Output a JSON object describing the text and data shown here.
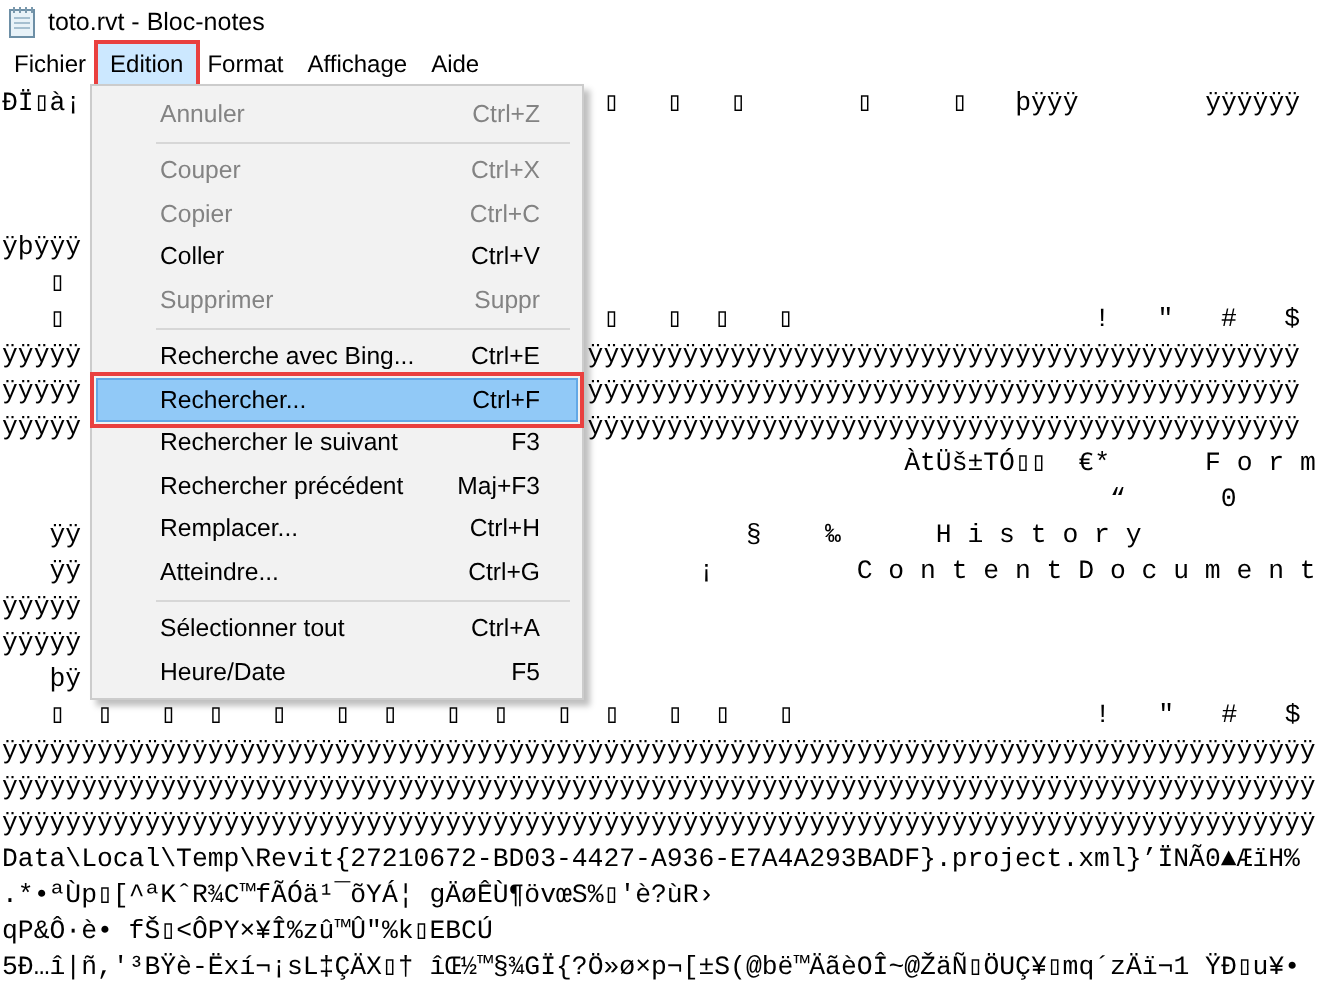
{
  "window": {
    "title": "toto.rvt - Bloc-notes"
  },
  "menu_bar": [
    {
      "label": "Fichier",
      "selected": false,
      "callout": false
    },
    {
      "label": "Edition",
      "selected": true,
      "callout": true
    },
    {
      "label": "Format",
      "selected": false,
      "callout": false
    },
    {
      "label": "Affichage",
      "selected": false,
      "callout": false
    },
    {
      "label": "Aide",
      "selected": false,
      "callout": false
    }
  ],
  "edit_menu": [
    {
      "kind": "item",
      "label": "Annuler",
      "shortcut": "Ctrl+Z",
      "disabled": true,
      "selected": false,
      "callout": false
    },
    {
      "kind": "separator"
    },
    {
      "kind": "item",
      "label": "Couper",
      "shortcut": "Ctrl+X",
      "disabled": true,
      "selected": false,
      "callout": false
    },
    {
      "kind": "item",
      "label": "Copier",
      "shortcut": "Ctrl+C",
      "disabled": true,
      "selected": false,
      "callout": false
    },
    {
      "kind": "item",
      "label": "Coller",
      "shortcut": "Ctrl+V",
      "disabled": false,
      "selected": false,
      "callout": false
    },
    {
      "kind": "item",
      "label": "Supprimer",
      "shortcut": "Suppr",
      "disabled": true,
      "selected": false,
      "callout": false
    },
    {
      "kind": "separator"
    },
    {
      "kind": "item",
      "label": "Recherche avec Bing...",
      "shortcut": "Ctrl+E",
      "disabled": false,
      "selected": false,
      "callout": false
    },
    {
      "kind": "item",
      "label": "Rechercher...",
      "shortcut": "Ctrl+F",
      "disabled": false,
      "selected": true,
      "callout": true
    },
    {
      "kind": "item",
      "label": "Rechercher le suivant",
      "shortcut": "F3",
      "disabled": false,
      "selected": false,
      "callout": false
    },
    {
      "kind": "item",
      "label": "Rechercher précédent",
      "shortcut": "Maj+F3",
      "disabled": false,
      "selected": false,
      "callout": false
    },
    {
      "kind": "item",
      "label": "Remplacer...",
      "shortcut": "Ctrl+H",
      "disabled": false,
      "selected": false,
      "callout": false
    },
    {
      "kind": "item",
      "label": "Atteindre...",
      "shortcut": "Ctrl+G",
      "disabled": false,
      "selected": false,
      "callout": false
    },
    {
      "kind": "separator"
    },
    {
      "kind": "item",
      "label": "Sélectionner tout",
      "shortcut": "Ctrl+A",
      "disabled": false,
      "selected": false,
      "callout": false
    },
    {
      "kind": "item",
      "label": "Heure/Date",
      "shortcut": "F5",
      "disabled": false,
      "selected": false,
      "callout": false
    }
  ],
  "document_lines": [
    {
      "kind": "split",
      "left": "ÐÏ▯à¡",
      "right": " ▯   ▯   ▯       ▯     ▯   þÿÿÿ        ÿÿÿÿÿÿ"
    },
    {
      "kind": "blank"
    },
    {
      "kind": "blank"
    },
    {
      "kind": "blank"
    },
    {
      "kind": "split",
      "left": "ÿþÿÿÿ"
    },
    {
      "kind": "split",
      "left": "   ▯"
    },
    {
      "kind": "split",
      "left": "   ▯",
      "right": " ▯   ▯  ▯   ▯                   !   \"   #   $"
    },
    {
      "kind": "split",
      "left": "ÿÿÿÿÿ",
      "right": "ÿÿÿÿÿÿÿÿÿÿÿÿÿÿÿÿÿÿÿÿÿÿÿÿÿÿÿÿÿÿÿÿÿÿÿÿÿÿÿÿÿÿÿÿÿ"
    },
    {
      "kind": "split",
      "left": "ÿÿÿÿÿ",
      "right": "ÿÿÿÿÿÿÿÿÿÿÿÿÿÿÿÿÿÿÿÿÿÿÿÿÿÿÿÿÿÿÿÿÿÿÿÿÿÿÿÿÿÿÿÿÿ"
    },
    {
      "kind": "split",
      "left": "ÿÿÿÿÿ",
      "right": "ÿÿÿÿÿÿÿÿÿÿÿÿÿÿÿÿÿÿÿÿÿÿÿÿÿÿÿÿÿÿÿÿÿÿÿÿÿÿÿÿÿÿÿÿÿ"
    },
    {
      "kind": "split",
      "right": "                    ÀtÜš±TÓ▯▯  €*      F o r m"
    },
    {
      "kind": "split",
      "right": "                                 “      0"
    },
    {
      "kind": "split",
      "left": "   ÿÿ",
      "right": "          §    ‰      H i s t o r y"
    },
    {
      "kind": "split",
      "left": "   ÿÿ",
      "right": "       ¡         C o n t e n t D o c u m e n t"
    },
    {
      "kind": "split",
      "left": "ÿÿÿÿÿ"
    },
    {
      "kind": "split",
      "left": "ÿÿÿÿÿ"
    },
    {
      "kind": "split",
      "left": "   þÿ"
    },
    {
      "kind": "full",
      "text": "   ▯  ▯   ▯  ▯   ▯   ▯  ▯   ▯  ▯   ▯  ▯   ▯  ▯   ▯                   !   \"   #   $"
    },
    {
      "kind": "full",
      "text": "ÿÿÿÿÿÿÿÿÿÿÿÿÿÿÿÿÿÿÿÿÿÿÿÿÿÿÿÿÿÿÿÿÿÿÿÿÿÿÿÿÿÿÿÿÿÿÿÿÿÿÿÿÿÿÿÿÿÿÿÿÿÿÿÿÿÿÿÿÿÿÿÿÿÿÿÿÿÿÿÿÿÿÿ"
    },
    {
      "kind": "full",
      "text": "ÿÿÿÿÿÿÿÿÿÿÿÿÿÿÿÿÿÿÿÿÿÿÿÿÿÿÿÿÿÿÿÿÿÿÿÿÿÿÿÿÿÿÿÿÿÿÿÿÿÿÿÿÿÿÿÿÿÿÿÿÿÿÿÿÿÿÿÿÿÿÿÿÿÿÿÿÿÿÿÿÿÿÿ"
    },
    {
      "kind": "full",
      "text": "ÿÿÿÿÿÿÿÿÿÿÿÿÿÿÿÿÿÿÿÿÿÿÿÿÿÿÿÿÿÿÿÿÿÿÿÿÿÿÿÿÿÿÿÿÿÿÿÿÿÿÿÿÿÿÿÿÿÿÿÿÿÿÿÿÿÿÿÿÿÿÿÿÿÿÿÿÿÿÿÿÿÿÿ"
    },
    {
      "kind": "full",
      "text": "Data\\Local\\Temp\\Revit{27210672-BD03-4427-A936-E7A4A293BADF}.project.xml}’ÏNÃ0▲ÆïH%"
    },
    {
      "kind": "full",
      "text": ".*•ªÙp▯[^ªKˆR¾C™fÃÓä¹¯õYÁ¦ gÄøÊÙ¶övœS%▯'è?ùR›"
    },
    {
      "kind": "full",
      "text": "qP&Ô·è• fŠ▯<ÔPY×¥Î%zû™Û\"%k▯EBCÚ"
    },
    {
      "kind": "full",
      "text": "5Ð…î|ñ,'³BŸè-Ëxí¬¡sL‡ÇÄX▯† îŒ½™§¾GÏ{?Ö»ø×p¬[±S(@bë™ÄãèOÎ~@ŽäÑ▯ÖUÇ¥▯mq´zÄï¬1 ŸÐ▯u¥•"
    }
  ]
}
